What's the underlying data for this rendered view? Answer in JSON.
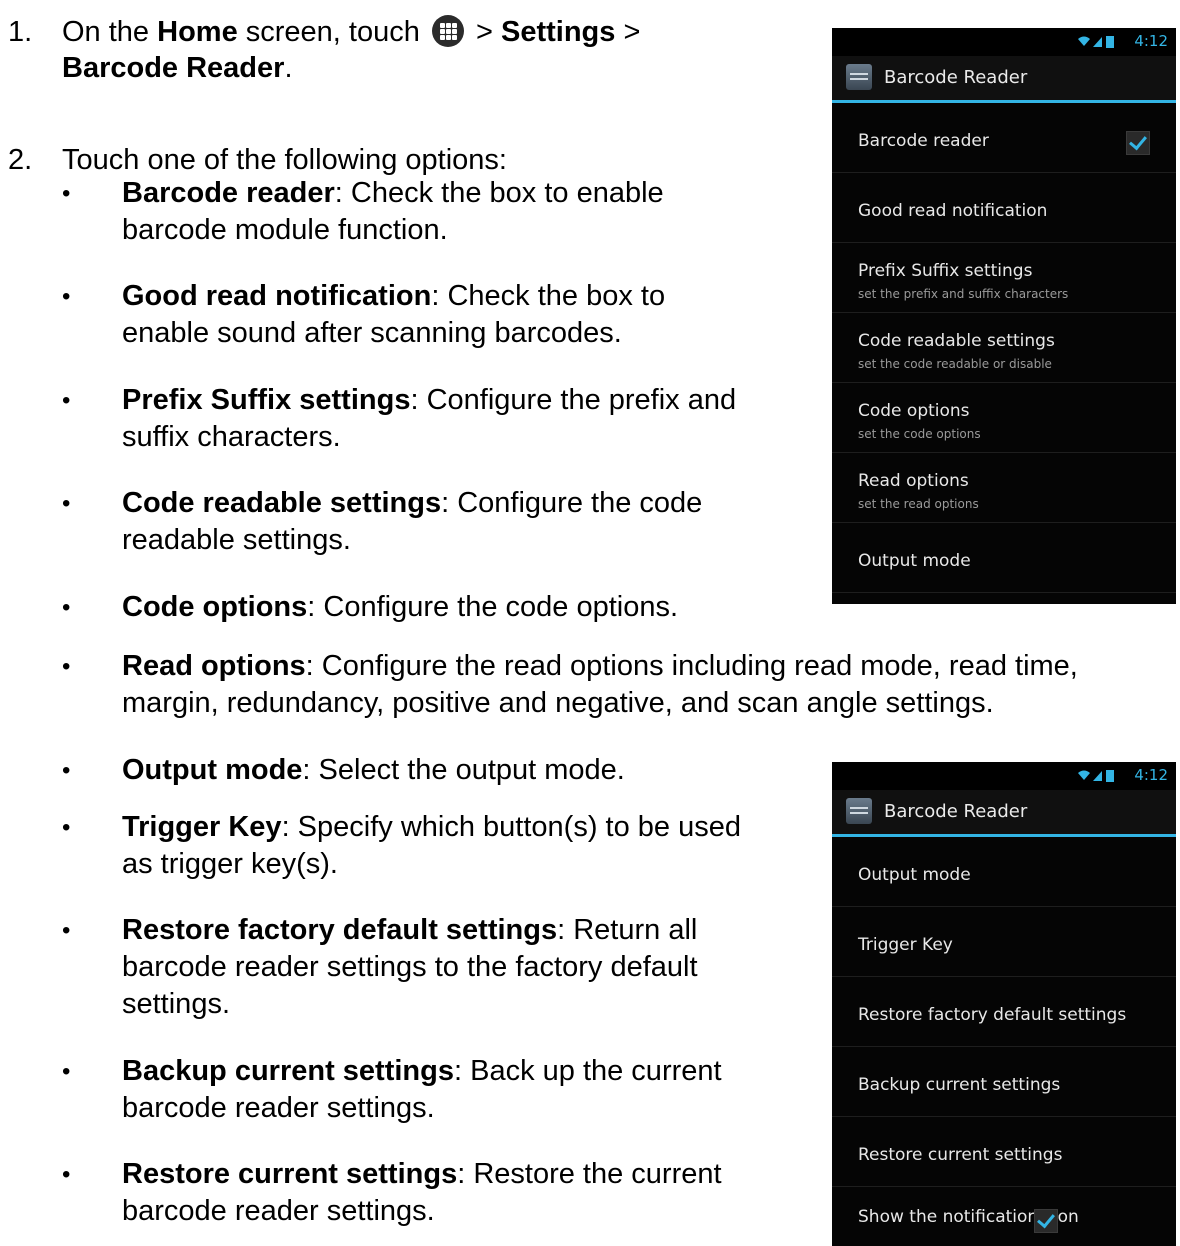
{
  "steps": [
    {
      "num": "1.",
      "pre": "On the ",
      "b1": "Home",
      "mid": " screen, touch ",
      "sep1": " > ",
      "b2": "Settings",
      "sep2": " >",
      "b3": "Barcode Reader",
      "end": "."
    },
    {
      "num": "2.",
      "text": "Touch one of the following options:"
    }
  ],
  "bullets": [
    {
      "term": "Barcode reader",
      "line1": ": Check the box to enable",
      "line2": "barcode module function."
    },
    {
      "term": "Good read notification",
      "line1": ": Check the box to",
      "line2": "enable sound after scanning barcodes."
    },
    {
      "term": "Prefix Suffix settings",
      "line1": ": Configure the prefix and",
      "line2": "suffix characters."
    },
    {
      "term": "Code readable settings",
      "line1": ": Configure the code",
      "line2": "readable settings."
    },
    {
      "term": "Code options",
      "line1": ": Configure the code options."
    },
    {
      "term": "Read options",
      "line1": ": Configure the read options including read mode, read time,",
      "line2": "margin, redundancy, positive and negative, and scan angle settings."
    },
    {
      "term": "Output mode",
      "line1": ": Select the output mode."
    },
    {
      "term": "Trigger Key",
      "line1": ": Specify which button(s) to be used",
      "line2": "as trigger key(s)."
    },
    {
      "term": "Restore factory default settings",
      "line1": ": Return all",
      "line2": "barcode reader settings to the factory default",
      "line3": "settings."
    },
    {
      "term": "Backup current settings",
      "line1": ": Back up the current",
      "line2": "barcode reader settings."
    },
    {
      "term": "Restore current settings",
      "line1": ": Restore the current",
      "line2": "barcode reader settings."
    }
  ],
  "bullet_glyph": "•",
  "icons": {
    "apps": "apps-grid-icon",
    "signal": "wifi-signal-battery-icon",
    "app": "barcode-reader-app-icon",
    "check": "checkbox-checked-icon"
  },
  "accent_color": "#33b5e5",
  "phone1": {
    "time": "4:12",
    "title": "Barcode Reader",
    "items": [
      {
        "label": "Barcode reader",
        "summary": "",
        "checked": true
      },
      {
        "label": "Good read notification",
        "summary": ""
      },
      {
        "label": "Prefix Suffix settings",
        "summary": "set the prefix and suffix characters"
      },
      {
        "label": "Code readable settings",
        "summary": "set the code readable or disable"
      },
      {
        "label": "Code options",
        "summary": "set the code options"
      },
      {
        "label": "Read options",
        "summary": "set the read options"
      },
      {
        "label": "Output mode",
        "summary": ""
      }
    ]
  },
  "phone2": {
    "time": "4:12",
    "title": "Barcode Reader",
    "items": [
      {
        "label": "Output mode"
      },
      {
        "label": "Trigger Key"
      },
      {
        "label": "Restore factory default settings"
      },
      {
        "label": "Backup current settings"
      },
      {
        "label": "Restore current settings"
      },
      {
        "label": "Show the notification icon",
        "checked": true
      }
    ]
  }
}
